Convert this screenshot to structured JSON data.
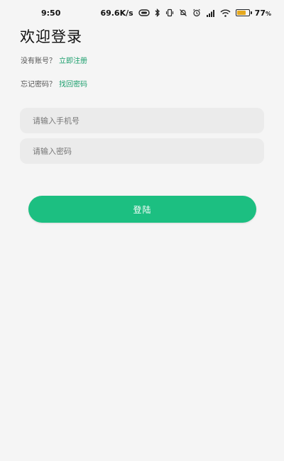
{
  "status_bar": {
    "time": "9:50",
    "network_speed": "69.6K/s",
    "battery_percent": "77",
    "battery_level": 0.77,
    "icons": [
      "nfc-icon",
      "bluetooth-icon",
      "vibrate-icon",
      "alarm-off-icon",
      "alarm-clock-icon",
      "signal-icon",
      "wifi-icon",
      "battery-icon"
    ]
  },
  "page": {
    "title": "欢迎登录"
  },
  "register": {
    "prompt": "没有账号？",
    "link": "立即注册"
  },
  "forgot": {
    "prompt": "忘记密码？",
    "link": "找回密码"
  },
  "form": {
    "phone_placeholder": "请输入手机号",
    "phone_value": "",
    "password_placeholder": "请输入密码",
    "password_value": ""
  },
  "login_button": {
    "label": "登陆"
  },
  "colors": {
    "accent": "#1cbf81",
    "link": "#1a9e6c",
    "background": "#f5f5f5",
    "input_background": "#ebebeb"
  }
}
